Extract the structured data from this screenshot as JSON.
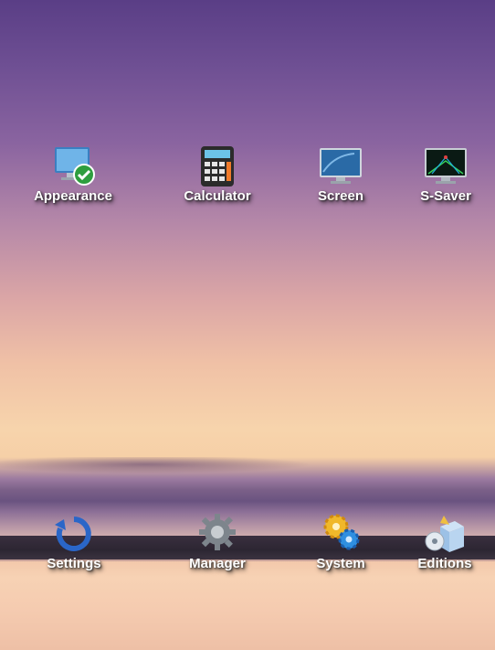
{
  "desktop": {
    "top_icons": [
      {
        "label": "Appearance",
        "icon": "appearance-icon"
      },
      {
        "label": "Calculator",
        "icon": "calculator-icon"
      },
      {
        "label": "Screen",
        "icon": "screen-icon"
      },
      {
        "label": "S-Saver",
        "icon": "screensaver-icon"
      }
    ],
    "bottom_icons": [
      {
        "label": "Settings",
        "icon": "settings-icon"
      },
      {
        "label": "Manager",
        "icon": "gear-icon"
      },
      {
        "label": "System",
        "icon": "system-gears-icon"
      },
      {
        "label": "Editions",
        "icon": "editions-box-icon"
      }
    ]
  },
  "colors": {
    "sky_top": "#5a3e86",
    "sky_mid": "#dba6a6",
    "horizon": "#f7d4ac",
    "label_text": "#ffffff"
  }
}
